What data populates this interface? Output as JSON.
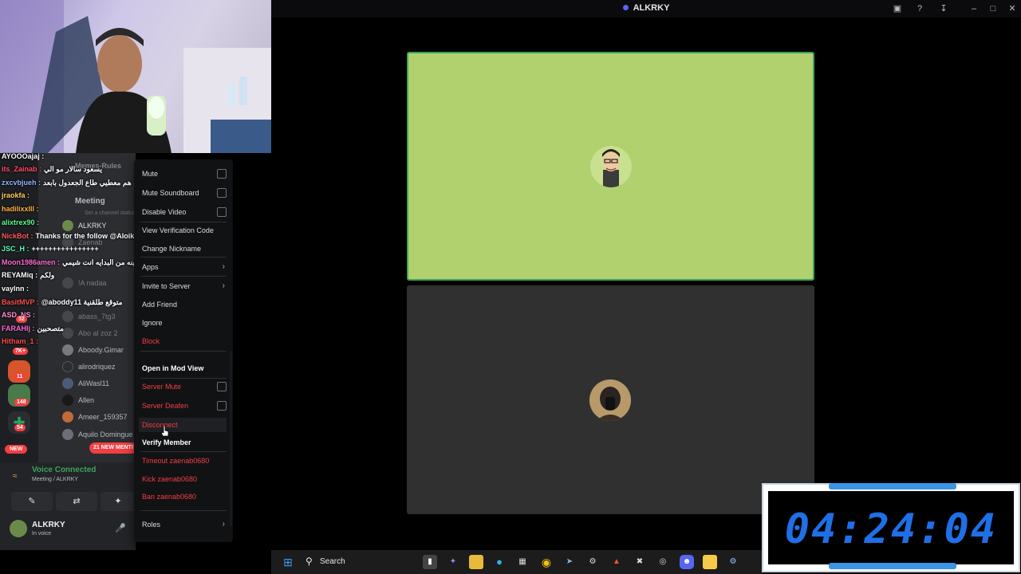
{
  "window": {
    "title": "ALKRKY",
    "icons": [
      "screen-share-icon",
      "help-icon",
      "download-icon",
      "minimize-icon",
      "maximize-icon",
      "close-icon"
    ]
  },
  "chat_overlay": [
    {
      "user": "AYOOOajaj :",
      "message": "",
      "color": "#ffffff"
    },
    {
      "user": "its_Zainab :",
      "message": "يسعود سالار مو الي",
      "color": "#ff4d6d"
    },
    {
      "user": "zxcvbjueh :",
      "message": "الله هم معطيي طاع الجعدول بابعد",
      "color": "#8fb7ff"
    },
    {
      "user": "jraokfa :",
      "message": "",
      "color": "#ffd35c"
    },
    {
      "user": "hadilixxlll :",
      "message": "",
      "color": "#ffb347"
    },
    {
      "user": "alixtrex90 :",
      "message": "",
      "color": "#5cff8f"
    },
    {
      "user": "NickBot :",
      "message": "Thanks for the follow @Aloikihlin",
      "color": "#ff5b5b"
    },
    {
      "user": "JSC_H :",
      "message": "++++++++++++++++",
      "color": "#5cffb0"
    },
    {
      "user": "Moon1986amen :",
      "message": "مبينه من البدايه انت شيمي",
      "color": "#ff6ad5"
    },
    {
      "user": "REYAMiq :",
      "message": "ولكم",
      "color": "#ffffff"
    },
    {
      "user": "vaylnn :",
      "message": "",
      "color": "#ffffff"
    },
    {
      "user": "BasitMVP :",
      "message": "@aboddy11 متوقع طلقنية",
      "color": "#ff4d4d"
    },
    {
      "user": "ASD_NS :",
      "message": "",
      "color": "#ff8fd0"
    },
    {
      "user": "FARAHIj :",
      "message": "متصحبين",
      "color": "#ff6ad5"
    },
    {
      "user": "Hitham_1 :",
      "message": "",
      "color": "#ff4d4d"
    }
  ],
  "channels": {
    "memes_rules": "Memes-Rules",
    "meeting": "Meeting",
    "meeting_status": "Set a channel status"
  },
  "members": [
    "ALKRKY",
    "Zaenab",
    "!A nadaa",
    "abass_7tg3",
    "Abo al zoz 2",
    "Aboody.Gimar",
    "alirodriquez",
    "AliWasl11",
    "Allen",
    "Ameer_159357",
    "Aquilo Domingue"
  ],
  "server_badges": [
    "11",
    "148",
    "54",
    "NEW",
    "7K+",
    "32"
  ],
  "new_mentions": "21 NEW MENTI",
  "voice": {
    "status": "Voice Connected",
    "location": "Meeting / ALKRKY",
    "user": "ALKRKY",
    "user_status": "In voice"
  },
  "context_menu": {
    "mute": "Mute",
    "mute_soundboard": "Mute Soundboard",
    "disable_video": "Disable Video",
    "view_verification": "View Verification Code",
    "change_nickname": "Change Nickname",
    "apps": "Apps",
    "invite_to_server": "Invite to Server",
    "add_friend": "Add Friend",
    "ignore": "Ignore",
    "block": "Block",
    "open_mod_view": "Open in Mod View",
    "server_mute": "Server Mute",
    "server_deafen": "Server Deafen",
    "disconnect": "Disconnect",
    "verify_member": "Verify Member",
    "timeout": "Timeout zaenab0680",
    "kick": "Kick zaenab0680",
    "ban": "Ban zaenab0680",
    "roles": "Roles"
  },
  "timer": {
    "value": "04:24:04"
  },
  "taskbar": {
    "search_label": "Search"
  },
  "colors": {
    "accent": "#5865f2",
    "danger": "#f23f43",
    "success": "#3ba55c",
    "stage_green": "#b1d16f",
    "timer_blue": "#1f6fe6"
  }
}
